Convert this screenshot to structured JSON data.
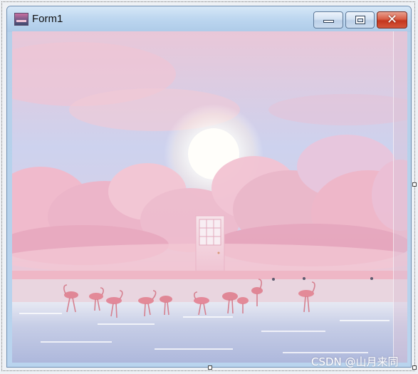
{
  "window": {
    "title": "Form1",
    "icon": "form-app-icon",
    "controls": {
      "minimize": "minimize-icon",
      "maximize": "maximize-icon",
      "close": "close-icon"
    }
  },
  "background_image": {
    "description_icon": "pink-sky-flamingo-door-scene"
  },
  "watermark": {
    "text": "CSDN @山月来同"
  },
  "colors": {
    "titlebar": "#bcd6ef",
    "close_button": "#c3361e",
    "sky": "#c9d4ee",
    "clouds": "#f2bccd"
  }
}
